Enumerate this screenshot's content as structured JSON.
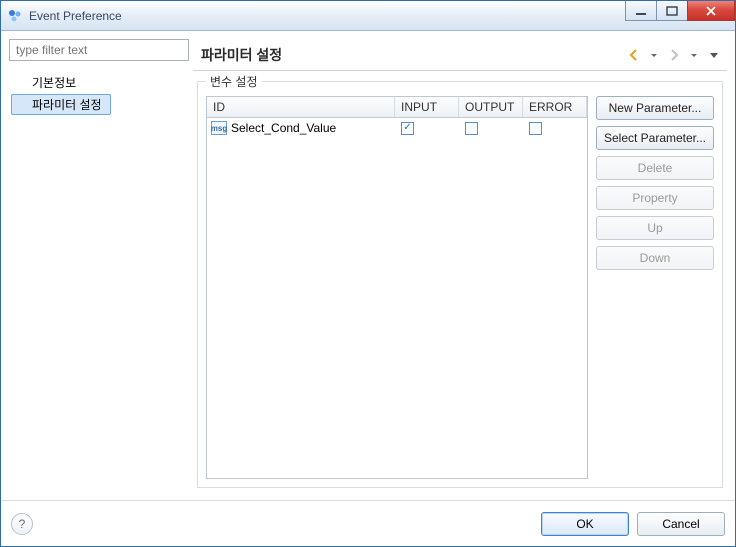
{
  "window": {
    "title": "Event Preference"
  },
  "filter": {
    "placeholder": "type filter text"
  },
  "tree": {
    "items": [
      {
        "label": "기본정보",
        "selected": false
      },
      {
        "label": "파라미터 설정",
        "selected": true
      }
    ]
  },
  "page": {
    "title": "파라미터 설정"
  },
  "group": {
    "label": "변수 설정"
  },
  "table": {
    "columns": {
      "id": "ID",
      "input": "INPUT",
      "output": "OUTPUT",
      "error": "ERROR"
    },
    "rows": [
      {
        "icon": "msg",
        "id": "Select_Cond_Value",
        "input": true,
        "output": false,
        "error": false
      }
    ]
  },
  "buttons": {
    "new": "New Parameter...",
    "select": "Select Parameter...",
    "delete": "Delete",
    "property": "Property",
    "up": "Up",
    "down": "Down"
  },
  "footer": {
    "ok": "OK",
    "cancel": "Cancel"
  }
}
